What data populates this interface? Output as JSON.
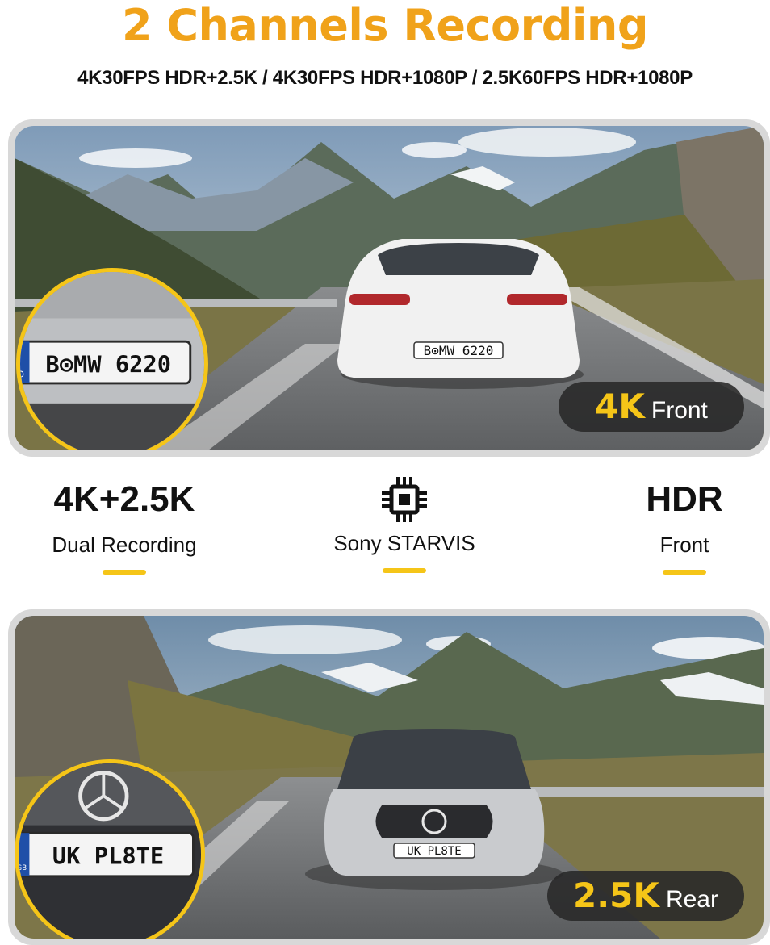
{
  "header": {
    "title": "2 Channels Recording",
    "modes": "4K30FPS HDR+2.5K / 4K30FPS HDR+1080P / 2.5K60FPS HDR+1080P"
  },
  "front_view": {
    "resolution": "4K",
    "position": "Front",
    "plate_text": "B⊙MW 6220",
    "plate_country": "D"
  },
  "features": [
    {
      "headline": "4K+2.5K",
      "caption": "Dual Recording",
      "icon": ""
    },
    {
      "headline": "",
      "caption": "Sony STARVIS",
      "icon": "chip-icon"
    },
    {
      "headline": "HDR",
      "caption": "Front",
      "icon": ""
    }
  ],
  "rear_view": {
    "resolution": "2.5K",
    "position": "Rear",
    "plate_text": "UK PL8TE",
    "plate_country": "GB"
  },
  "colors": {
    "title": "#f0a21a",
    "accent": "#f5c518",
    "badge_bg": "#282828"
  }
}
